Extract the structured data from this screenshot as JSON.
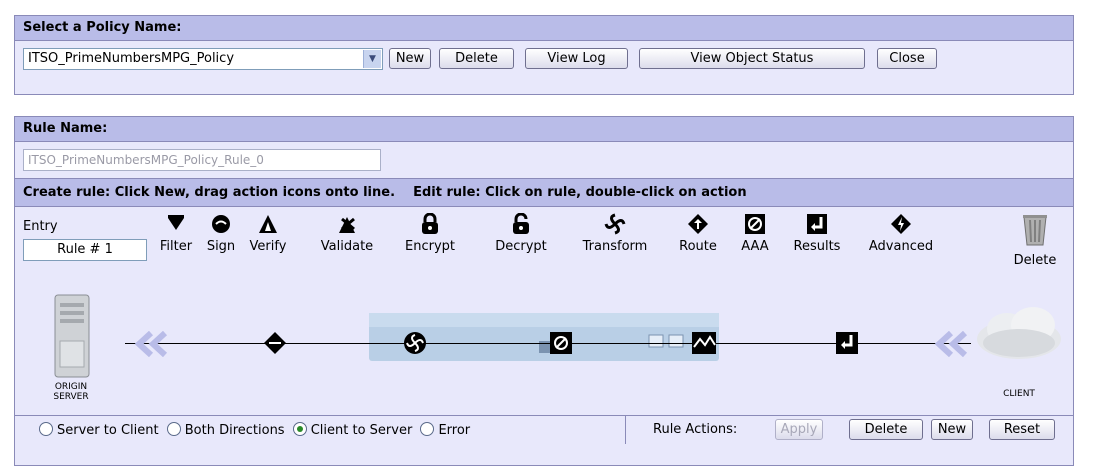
{
  "policy": {
    "header": "Select a Policy Name:",
    "selected": "ITSO_PrimeNumbersMPG_Policy",
    "buttons": {
      "new": "New",
      "delete": "Delete",
      "view_log": "View Log",
      "view_status": "View Object Status",
      "close": "Close"
    }
  },
  "rule": {
    "header": "Rule Name:",
    "name_value": "ITSO_PrimeNumbersMPG_Policy_Rule_0",
    "instructions": "Create rule: Click New, drag action icons onto line.    Edit rule: Click on rule, double-click on action",
    "entry_label": "Entry",
    "entry_value": "Rule # 1",
    "tools": [
      {
        "label": "Filter",
        "icon": "filter-icon"
      },
      {
        "label": "Sign",
        "icon": "sign-icon"
      },
      {
        "label": "Verify",
        "icon": "verify-icon"
      },
      {
        "label": "Validate",
        "icon": "validate-icon"
      },
      {
        "label": "Encrypt",
        "icon": "encrypt-icon"
      },
      {
        "label": "Decrypt",
        "icon": "decrypt-icon"
      },
      {
        "label": "Transform",
        "icon": "transform-icon"
      },
      {
        "label": "Route",
        "icon": "route-icon"
      },
      {
        "label": "AAA",
        "icon": "aaa-icon"
      },
      {
        "label": "Results",
        "icon": "results-icon"
      },
      {
        "label": "Advanced",
        "icon": "advanced-icon"
      }
    ],
    "delete_label": "Delete",
    "origin_label_1": "ORIGIN",
    "origin_label_2": "SERVER",
    "client_label": "CLIENT",
    "directions": [
      {
        "label": "Server to Client",
        "selected": false
      },
      {
        "label": "Both Directions",
        "selected": false
      },
      {
        "label": "Client to Server",
        "selected": true
      },
      {
        "label": "Error",
        "selected": false
      }
    ],
    "rule_actions_label": "Rule Actions:",
    "actions": {
      "apply": "Apply",
      "delete": "Delete",
      "new": "New",
      "reset": "Reset"
    }
  },
  "colors": {
    "header_bg": "#b9bce8",
    "panel_bg": "#e8e8fb",
    "border": "#8a8ab8"
  }
}
